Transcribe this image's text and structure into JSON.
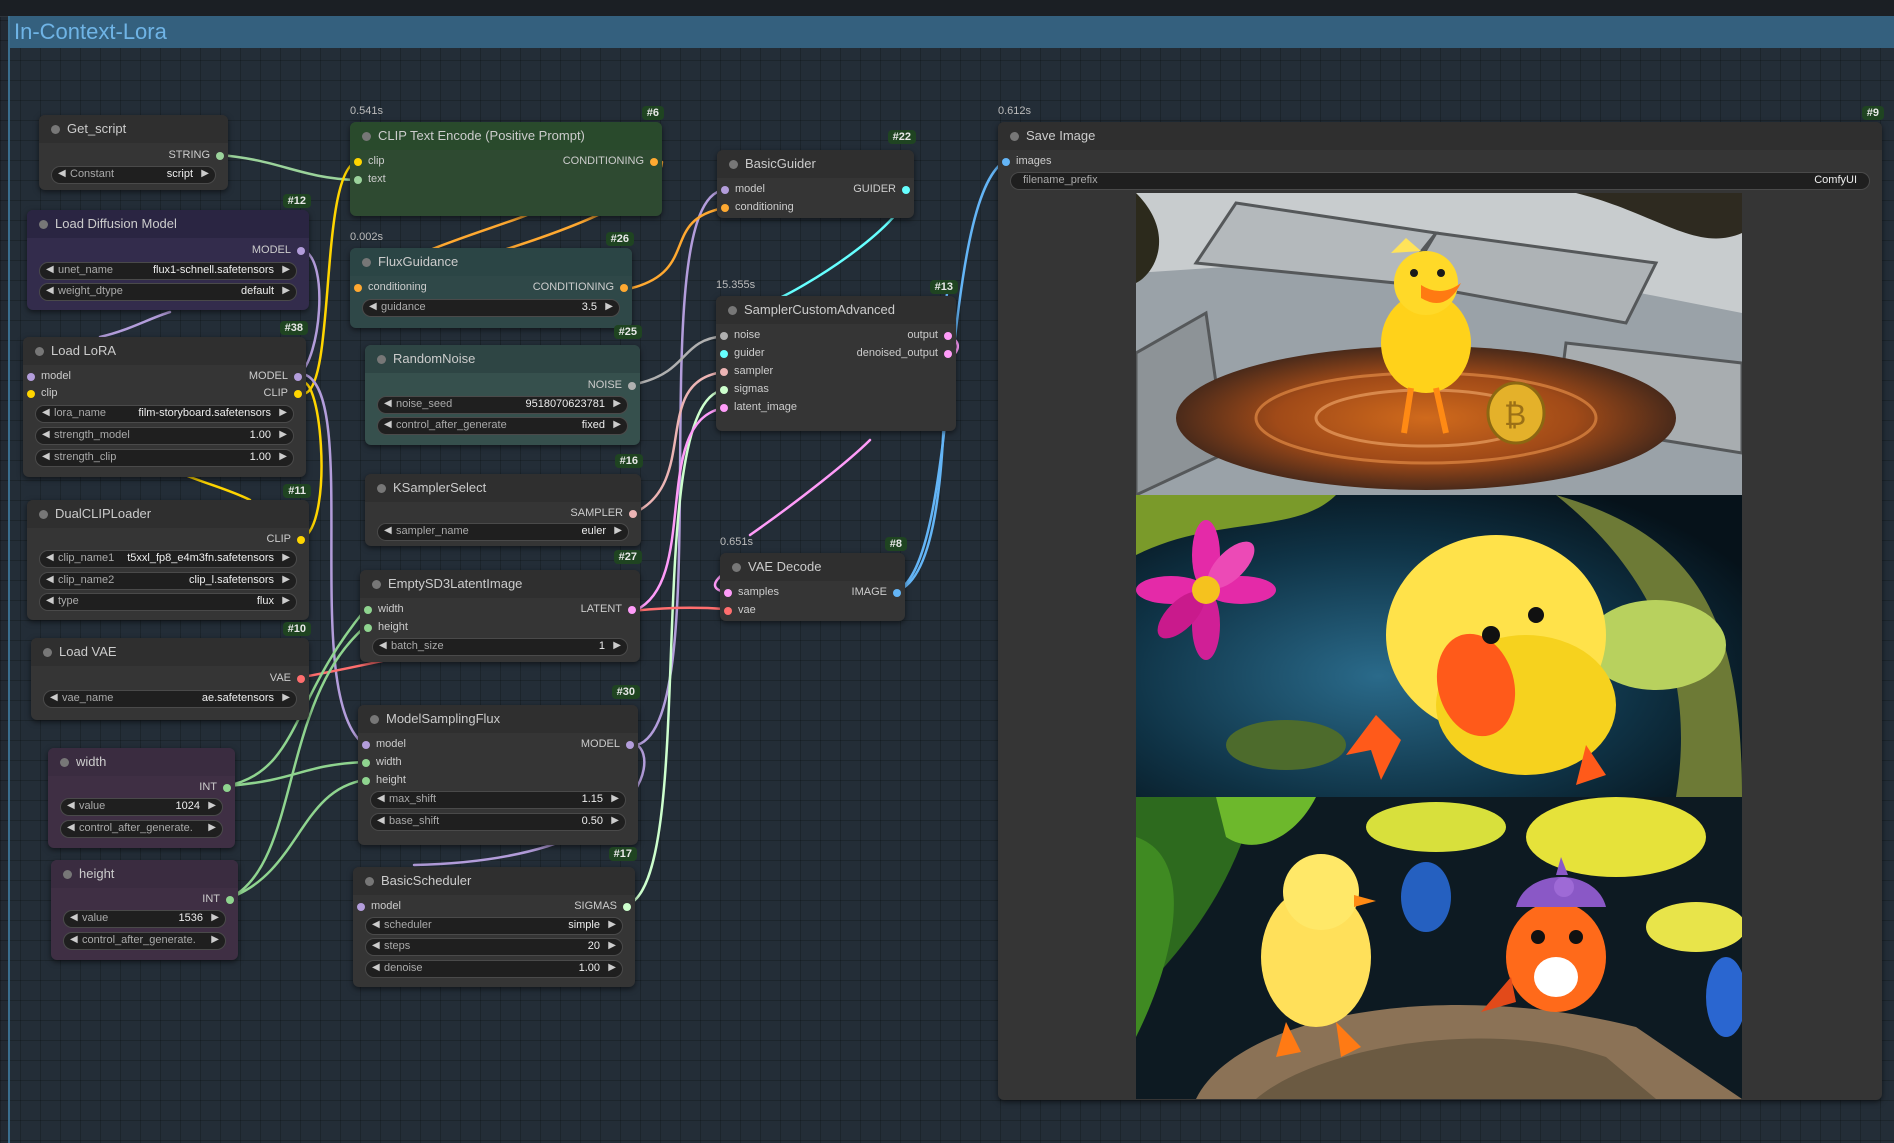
{
  "group": {
    "title": "In-Context-Lora"
  },
  "colors": {
    "STRING": "#9bd39b",
    "MODEL": "#b39ddb",
    "CLIP": "#ffd500",
    "CONDITIONING": "#ffa931",
    "GUIDER": "#66ffff",
    "NOISE": "#b0b0b0",
    "SAMPLER": "#ecb4b4",
    "SIGMAS": "#cdffcd",
    "LATENT": "#ff9cf9",
    "IMAGE": "#64b5f6",
    "VAE": "#ff6e6e",
    "INT": "#8fd48f"
  },
  "nodes": {
    "get_script": {
      "title": "Get_script",
      "out": "STRING",
      "w_name": "Constant",
      "w_value": "script"
    },
    "load_diffusion": {
      "id": "#12",
      "title": "Load Diffusion Model",
      "out": "MODEL",
      "unet_name_label": "unet_name",
      "unet_name": "flux1-schnell.safetensors",
      "weight_dtype_label": "weight_dtype",
      "weight_dtype": "default"
    },
    "load_lora": {
      "id": "#38",
      "title": "Load LoRA",
      "in_model": "model",
      "in_clip": "clip",
      "out_model": "MODEL",
      "out_clip": "CLIP",
      "lora_name_label": "lora_name",
      "lora_name": "film-storyboard.safetensors",
      "strength_model_label": "strength_model",
      "strength_model": "1.00",
      "strength_clip_label": "strength_clip",
      "strength_clip": "1.00"
    },
    "dual_clip": {
      "id": "#11",
      "title": "DualCLIPLoader",
      "out": "CLIP",
      "clip_name1_label": "clip_name1",
      "clip_name1": "t5xxl_fp8_e4m3fn.safetensors",
      "clip_name2_label": "clip_name2",
      "clip_name2": "clip_l.safetensors",
      "type_label": "type",
      "type": "flux"
    },
    "load_vae": {
      "id": "#10",
      "title": "Load VAE",
      "out": "VAE",
      "vae_name_label": "vae_name",
      "vae_name": "ae.safetensors"
    },
    "width": {
      "title": "width",
      "out": "INT",
      "value_label": "value",
      "value": "1024",
      "cag_label": "control_after_generate."
    },
    "height": {
      "title": "height",
      "out": "INT",
      "value_label": "value",
      "value": "1536",
      "cag_label": "control_after_generate."
    },
    "clip_text": {
      "id": "#6",
      "time": "0.541s",
      "title": "CLIP Text Encode (Positive Prompt)",
      "in_clip": "clip",
      "in_text": "text",
      "out": "CONDITIONING"
    },
    "flux_guidance": {
      "id": "#26",
      "time": "0.002s",
      "title": "FluxGuidance",
      "in": "conditioning",
      "out": "CONDITIONING",
      "guidance_label": "guidance",
      "guidance": "3.5"
    },
    "random_noise": {
      "id": "#25",
      "title": "RandomNoise",
      "out": "NOISE",
      "seed_label": "noise_seed",
      "seed": "9518070623781",
      "cag_label": "control_after_generate",
      "cag": "fixed"
    },
    "ksampler_select": {
      "id": "#16",
      "title": "KSamplerSelect",
      "out": "SAMPLER",
      "sampler_label": "sampler_name",
      "sampler": "euler"
    },
    "empty_latent": {
      "id": "#27",
      "title": "EmptySD3LatentImage",
      "in_width": "width",
      "in_height": "height",
      "out": "LATENT",
      "batch_label": "batch_size",
      "batch": "1"
    },
    "model_sampling": {
      "id": "#30",
      "title": "ModelSamplingFlux",
      "in_model": "model",
      "in_width": "width",
      "in_height": "height",
      "out": "MODEL",
      "max_shift_label": "max_shift",
      "max_shift": "1.15",
      "base_shift_label": "base_shift",
      "base_shift": "0.50"
    },
    "basic_scheduler": {
      "id": "#17",
      "title": "BasicScheduler",
      "in_model": "model",
      "out": "SIGMAS",
      "scheduler_label": "scheduler",
      "scheduler": "simple",
      "steps_label": "steps",
      "steps": "20",
      "denoise_label": "denoise",
      "denoise": "1.00"
    },
    "basic_guider": {
      "id": "#22",
      "title": "BasicGuider",
      "in_model": "model",
      "in_cond": "conditioning",
      "out": "GUIDER"
    },
    "sampler_custom": {
      "id": "#13",
      "time": "15.355s",
      "title": "SamplerCustomAdvanced",
      "in_noise": "noise",
      "in_guider": "guider",
      "in_sampler": "sampler",
      "in_sigmas": "sigmas",
      "in_latent": "latent_image",
      "out_output": "output",
      "out_denoised": "denoised_output"
    },
    "vae_decode": {
      "id": "#8",
      "time": "0.651s",
      "title": "VAE Decode",
      "in_samples": "samples",
      "in_vae": "vae",
      "out": "IMAGE"
    },
    "save_image": {
      "id": "#9",
      "time": "0.612s",
      "title": "Save Image",
      "in_images": "images",
      "prefix_label": "filename_prefix",
      "prefix": "ComfyUI"
    }
  }
}
